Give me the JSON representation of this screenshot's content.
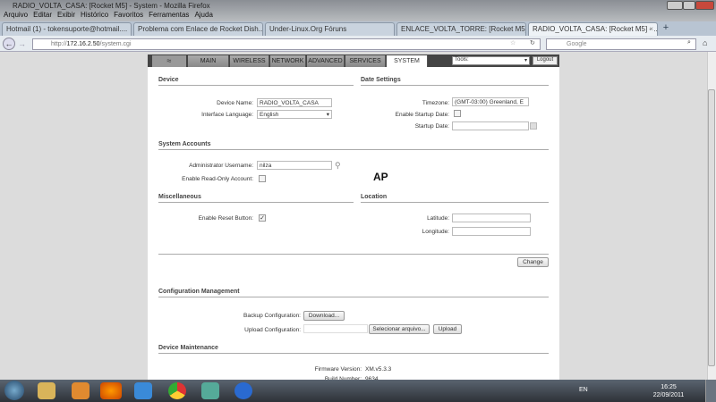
{
  "window": {
    "title": "RADIO_VOLTA_CASA: [Rocket M5] - System - Mozilla Firefox"
  },
  "menu": [
    "Arquivo",
    "Editar",
    "Exibir",
    "Histórico",
    "Favoritos",
    "Ferramentas",
    "Ajuda"
  ],
  "tabs": [
    {
      "label": "Hotmail (1) - tokensuporte@hotmail....",
      "active": false
    },
    {
      "label": "Problema com Enlace de Rocket Dish...",
      "active": false
    },
    {
      "label": "Under-Linux.Org Fóruns",
      "active": false
    },
    {
      "label": "ENLACE_VOLTA_TORRE: [Rocket M5]...",
      "active": false
    },
    {
      "label": "RADIO_VOLTA_CASA: [Rocket M5] - ...",
      "active": true
    }
  ],
  "nav": {
    "url_prefix": "http://",
    "url_host": "172.16.2.50",
    "url_path": "/system.cgi",
    "search_placeholder": "Google"
  },
  "ui": {
    "tabs": [
      "MAIN",
      "WIRELESS",
      "NETWORK",
      "ADVANCED",
      "SERVICES",
      "SYSTEM"
    ],
    "tools_value": "Tools:",
    "logout": "Logout",
    "device": {
      "title": "Device",
      "name_label": "Device Name:",
      "name_value": "RADIO_VOLTA_CASA",
      "lang_label": "Interface Language:",
      "lang_value": "English"
    },
    "date": {
      "title": "Date Settings",
      "tz_label": "Timezone:",
      "tz_value": "(GMT-03:00) Greenland, E",
      "startup_enable_label": "Enable Startup Date:",
      "startup_label": "Startup Date:",
      "startup_value": ""
    },
    "accounts": {
      "title": "System Accounts",
      "admin_label": "Administrator Username:",
      "admin_value": "nilza",
      "readonly_label": "Enable Read-Only Account:"
    },
    "ap_label": "AP",
    "misc": {
      "title": "Miscellaneous",
      "reset_label": "Enable Reset Button:",
      "reset_checked": true
    },
    "location": {
      "title": "Location",
      "lat_label": "Latitude:",
      "lon_label": "Longitude:"
    },
    "change": "Change",
    "config": {
      "title": "Configuration Management",
      "backup_label": "Backup Configuration:",
      "download": "Download...",
      "upload_label": "Upload Configuration:",
      "choose": "Selecionar arquivo...",
      "upload": "Upload"
    },
    "maint": {
      "title": "Device Maintenance",
      "fw_label": "Firmware Version:",
      "fw_value": "XM.v5.3.3",
      "build_label": "Build Number:",
      "build_value": "9634"
    }
  },
  "taskbar": {
    "lang": "EN",
    "time": "16:25",
    "date": "22/09/2011"
  }
}
